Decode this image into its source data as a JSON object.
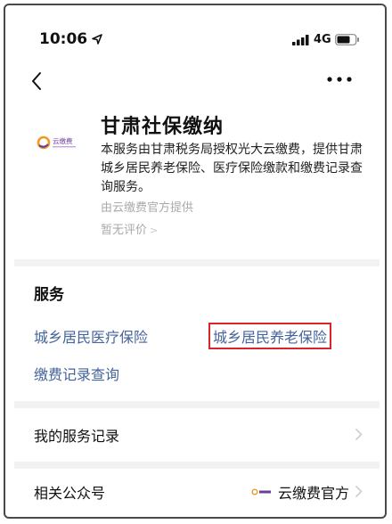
{
  "status_bar": {
    "time": "10:06",
    "network": "4G"
  },
  "nav": {
    "back_icon": "chevron-left-icon",
    "more_icon": "more-dots-icon"
  },
  "service_header": {
    "logo_text": "云缴费",
    "title": "甘肃社保缴纳",
    "description": "本服务由甘肃税务局授权光大云缴费，提供甘肃城乡居民养老保险、医疗保险缴款和缴费记录查询服务。",
    "provider": "由云缴费官方提供",
    "rating": "暂无评价"
  },
  "services": {
    "title": "服务",
    "items": [
      {
        "label": "城乡居民医疗保险"
      },
      {
        "label": "城乡居民养老保险",
        "highlighted": true
      },
      {
        "label": "缴费记录查询"
      }
    ]
  },
  "rows": {
    "service_records": {
      "label": "我的服务记录"
    },
    "official_account": {
      "label": "相关公众号",
      "value": "云缴费官方"
    }
  },
  "colors": {
    "link": "#44649a",
    "highlight_border": "#d6262b",
    "divider": "#f2f2f2",
    "logo_orange": "#f29a1f",
    "logo_purple": "#6a3f9c"
  }
}
